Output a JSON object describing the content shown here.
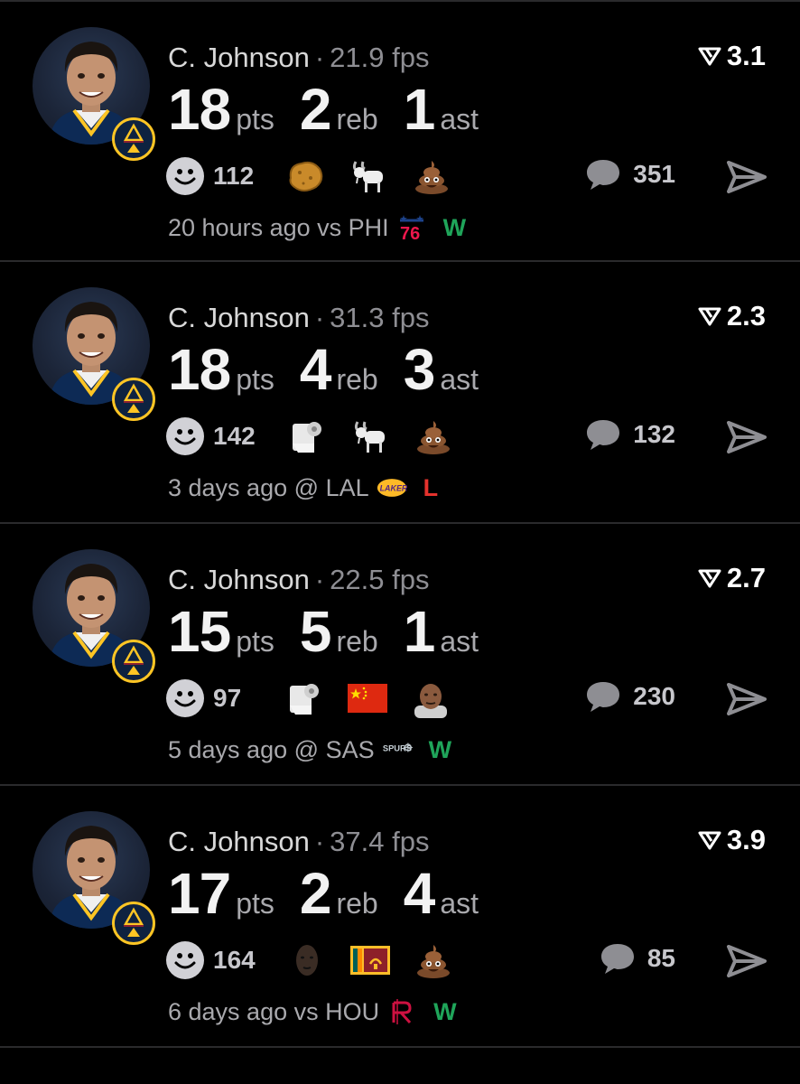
{
  "posts": [
    {
      "player": "C. Johnson",
      "separator": "·",
      "fps": "21.9 fps",
      "rating": "3.1",
      "stats": [
        {
          "value": "18",
          "unit": "pts"
        },
        {
          "value": "2",
          "unit": "reb"
        },
        {
          "value": "1",
          "unit": "ast"
        }
      ],
      "reaction_count": "112",
      "reaction_emojis": [
        "nugget-icon",
        "goat-icon",
        "poop-icon"
      ],
      "comment_count": "351",
      "time": "20 hours ago",
      "venue": "vs",
      "opponent": "PHI",
      "opponent_logo": "76ers-logo-icon",
      "result": "W",
      "result_color": "#1fa55a"
    },
    {
      "player": "C. Johnson",
      "separator": "·",
      "fps": "31.3 fps",
      "rating": "2.3",
      "stats": [
        {
          "value": "18",
          "unit": "pts"
        },
        {
          "value": "4",
          "unit": "reb"
        },
        {
          "value": "3",
          "unit": "ast"
        }
      ],
      "reaction_count": "142",
      "reaction_emojis": [
        "toilet-paper-icon",
        "goat-icon",
        "poop-icon"
      ],
      "comment_count": "132",
      "time": "3 days ago",
      "venue": "@",
      "opponent": "LAL",
      "opponent_logo": "lakers-logo-icon",
      "result": "L",
      "result_color": "#e5322d"
    },
    {
      "player": "C. Johnson",
      "separator": "·",
      "fps": "22.5 fps",
      "rating": "2.7",
      "stats": [
        {
          "value": "15",
          "unit": "pts"
        },
        {
          "value": "5",
          "unit": "reb"
        },
        {
          "value": "1",
          "unit": "ast"
        }
      ],
      "reaction_count": "97",
      "reaction_emojis": [
        "toilet-paper-icon",
        "china-flag-icon",
        "person-face-icon"
      ],
      "comment_count": "230",
      "time": "5 days ago",
      "venue": "@",
      "opponent": "SAS",
      "opponent_logo": "spurs-logo-icon",
      "result": "W",
      "result_color": "#1fa55a"
    },
    {
      "player": "C. Johnson",
      "separator": "·",
      "fps": "37.4 fps",
      "rating": "3.9",
      "stats": [
        {
          "value": "17",
          "unit": "pts"
        },
        {
          "value": "2",
          "unit": "reb"
        },
        {
          "value": "4",
          "unit": "ast"
        }
      ],
      "reaction_count": "164",
      "reaction_emojis": [
        "dark-face-icon",
        "sri-lanka-flag-icon",
        "poop-icon"
      ],
      "comment_count": "85",
      "time": "6 days ago",
      "venue": "vs",
      "opponent": "HOU",
      "opponent_logo": "rockets-logo-icon",
      "result": "W",
      "result_color": "#1fa55a"
    }
  ],
  "colors": {
    "background": "#000000",
    "divider": "#2a2a2c",
    "muted": "#8e8e93",
    "badge_gold": "#fec524",
    "badge_navy": "#0e2240"
  }
}
